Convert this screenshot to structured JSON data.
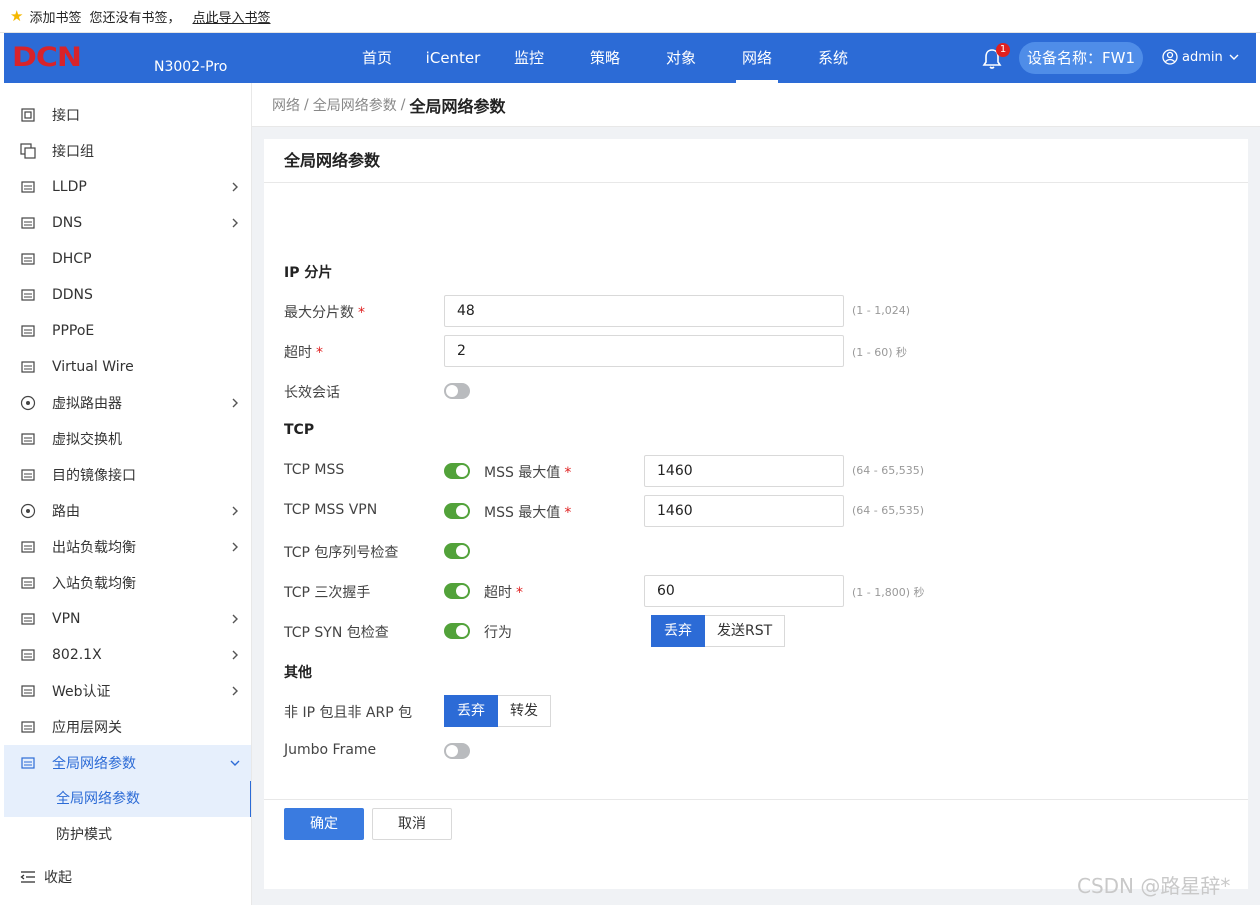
{
  "bookmarks": {
    "add_label": "添加书签",
    "empty_text": "您还没有书签，",
    "import_link": "点此导入书签"
  },
  "header": {
    "logo_text": "DCN",
    "model": "N3002-Pro",
    "nav": [
      "首页",
      "iCenter",
      "监控",
      "策略",
      "对象",
      "网络",
      "系统"
    ],
    "active_nav": "网络",
    "notification_count": "1",
    "device_label": "设备名称：FW1",
    "user": "admin"
  },
  "sidebar": {
    "items": [
      {
        "label": "接口",
        "icon": "interface-icon",
        "chevron": false
      },
      {
        "label": "接口组",
        "icon": "interface-group-icon",
        "chevron": false
      },
      {
        "label": "LLDP",
        "icon": "lldp-icon",
        "chevron": true
      },
      {
        "label": "DNS",
        "icon": "dns-icon",
        "chevron": true
      },
      {
        "label": "DHCP",
        "icon": "dhcp-icon",
        "chevron": false
      },
      {
        "label": "DDNS",
        "icon": "ddns-icon",
        "chevron": false
      },
      {
        "label": "PPPoE",
        "icon": "pppoe-icon",
        "chevron": false
      },
      {
        "label": "Virtual Wire",
        "icon": "virtual-wire-icon",
        "chevron": false
      },
      {
        "label": "虚拟路由器",
        "icon": "virtual-router-icon",
        "chevron": true
      },
      {
        "label": "虚拟交换机",
        "icon": "virtual-switch-icon",
        "chevron": false
      },
      {
        "label": "目的镜像接口",
        "icon": "mirror-interface-icon",
        "chevron": false
      },
      {
        "label": "路由",
        "icon": "route-icon",
        "chevron": true
      },
      {
        "label": "出站负载均衡",
        "icon": "outbound-lb-icon",
        "chevron": true
      },
      {
        "label": "入站负载均衡",
        "icon": "inbound-lb-icon",
        "chevron": false
      },
      {
        "label": "VPN",
        "icon": "vpn-icon",
        "chevron": true
      },
      {
        "label": "802.1X",
        "icon": "dot1x-icon",
        "chevron": true
      },
      {
        "label": "Web认证",
        "icon": "web-auth-icon",
        "chevron": true
      },
      {
        "label": "应用层网关",
        "icon": "alg-icon",
        "chevron": false
      },
      {
        "label": "全局网络参数",
        "icon": "global-params-icon",
        "chevron": true
      }
    ],
    "subitems": [
      "全局网络参数",
      "防护模式"
    ],
    "collapse_label": "收起"
  },
  "breadcrumb": [
    "网络",
    "全局网络参数",
    "全局网络参数"
  ],
  "card": {
    "title": "全局网络参数",
    "ip_section": "IP 分片",
    "max_frag_label": "最大分片数",
    "max_frag_value": "48",
    "max_frag_hint": "(1 - 1,024)",
    "timeout_label": "超时",
    "timeout_value": "2",
    "timeout_hint": "(1 - 60) 秒",
    "long_session_label": "长效会话",
    "long_session_on": false,
    "tcp_section": "TCP",
    "tcp_mss_label": "TCP MSS",
    "tcp_mss_on": true,
    "mss_max_label": "MSS 最大值",
    "tcp_mss_value": "1460",
    "tcp_mss_hint": "(64 - 65,535)",
    "tcp_mss_vpn_label": "TCP MSS VPN",
    "tcp_mss_vpn_on": true,
    "tcp_mss_vpn_value": "1460",
    "tcp_mss_vpn_hint": "(64 - 65,535)",
    "tcp_seq_label": "TCP 包序列号检查",
    "tcp_seq_on": true,
    "tcp_handshake_label": "TCP 三次握手",
    "tcp_handshake_on": true,
    "handshake_timeout_label": "超时",
    "handshake_timeout_value": "60",
    "handshake_timeout_hint": "(1 - 1,800) 秒",
    "tcp_syn_label": "TCP SYN 包检查",
    "tcp_syn_on": true,
    "action_label": "行为",
    "syn_actions": [
      "丢弃",
      "发送RST"
    ],
    "syn_action_selected": "丢弃",
    "other_section": "其他",
    "non_ip_label": "非 IP 包且非 ARP 包",
    "non_ip_actions": [
      "丢弃",
      "转发"
    ],
    "non_ip_selected": "丢弃",
    "jumbo_label": "Jumbo Frame",
    "jumbo_on": false,
    "ok_label": "确定",
    "cancel_label": "取消"
  },
  "watermark": "CSDN @路星辞*",
  "colors": {
    "header_bg": "#2c6bd6",
    "toggle_on": "#52a23a",
    "primary": "#3a7be0",
    "logo_red": "#d8232a"
  }
}
